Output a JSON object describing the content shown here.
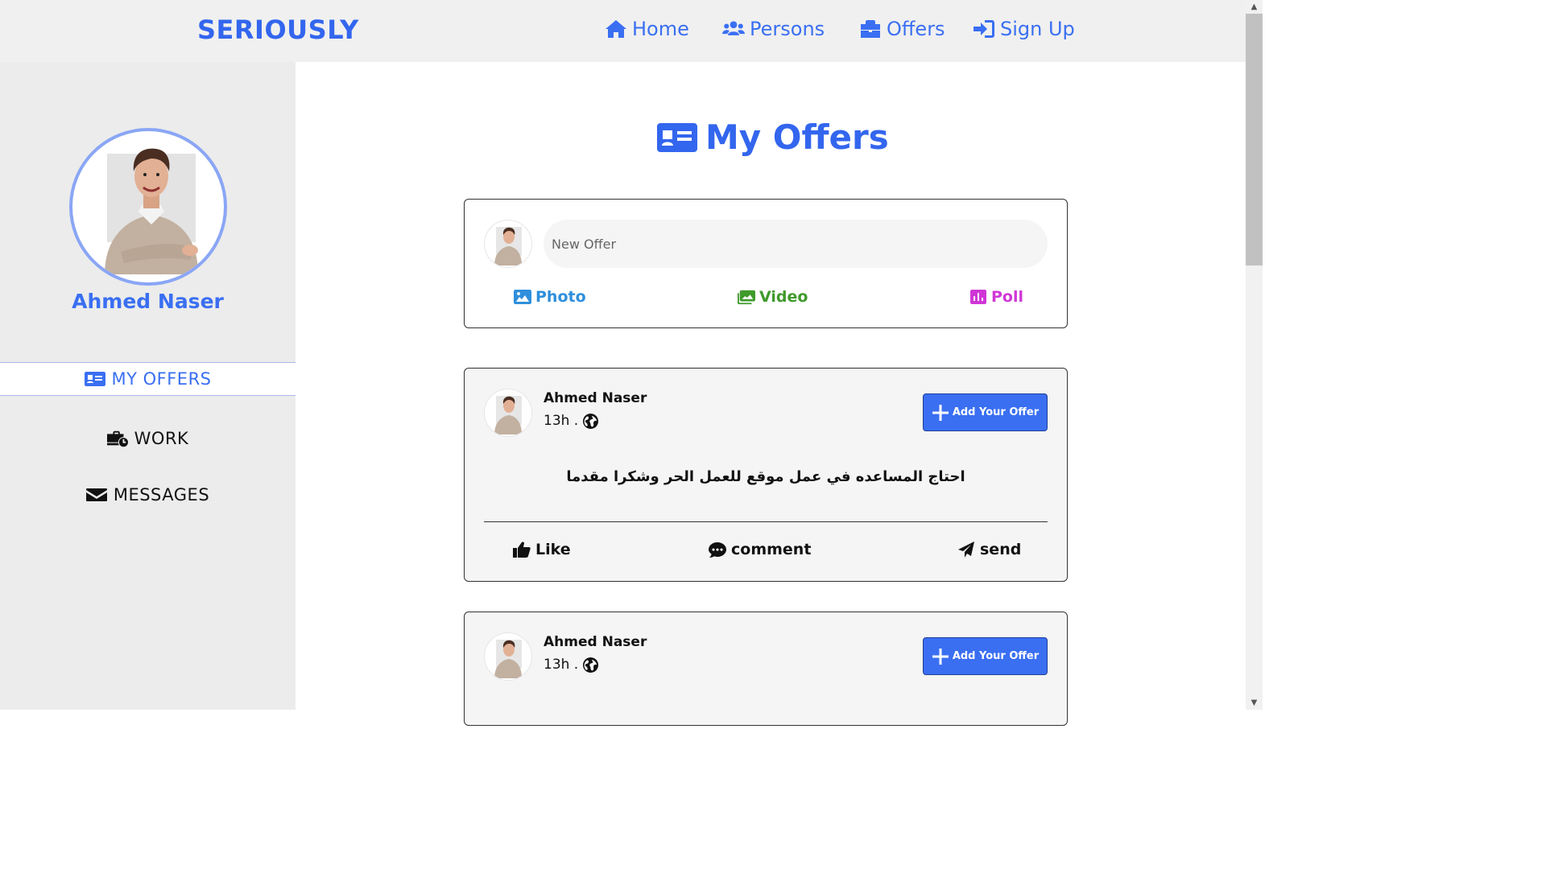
{
  "brand": {
    "name": "SERIOUSLY",
    "color": "#3366ee"
  },
  "nav": {
    "home": {
      "label": "Home",
      "icon": "home-icon"
    },
    "persons": {
      "label": "Persons",
      "icon": "users-icon"
    },
    "offers": {
      "label": "Offers",
      "icon": "briefcase-icon"
    },
    "signup": {
      "label": "Sign Up",
      "icon": "sign-in-icon"
    }
  },
  "sidebar": {
    "profile_name": "Ahmed Naser",
    "items": [
      {
        "label": "MY OFFERS",
        "icon": "id-card-icon",
        "active": true
      },
      {
        "label": "WORK",
        "icon": "business-time-icon",
        "active": false
      },
      {
        "label": "MESSAGES",
        "icon": "envelope-icon",
        "active": false
      }
    ]
  },
  "main": {
    "title": "My Offers",
    "title_icon": "id-card-icon",
    "composer": {
      "placeholder": "New Offer",
      "actions": [
        {
          "label": "Photo",
          "icon": "image-icon",
          "color": "#2f8fdc"
        },
        {
          "label": "Video",
          "icon": "images-icon",
          "color": "#3f9a2c"
        },
        {
          "label": "Poll",
          "icon": "poll-icon",
          "color": "#d036d6"
        }
      ]
    },
    "posts": [
      {
        "author": "Ahmed Naser",
        "time": "13h .",
        "add_button": "Add Your Offer",
        "text": "احتاج المساعده في عمل موقع للعمل الحر وشكرا مقدما",
        "actions": [
          "Like",
          "comment",
          "send"
        ]
      },
      {
        "author": "Ahmed Naser",
        "time": "13h .",
        "add_button": "Add Your Offer",
        "text": ""
      }
    ]
  },
  "accent_color": "#3a6ff2"
}
